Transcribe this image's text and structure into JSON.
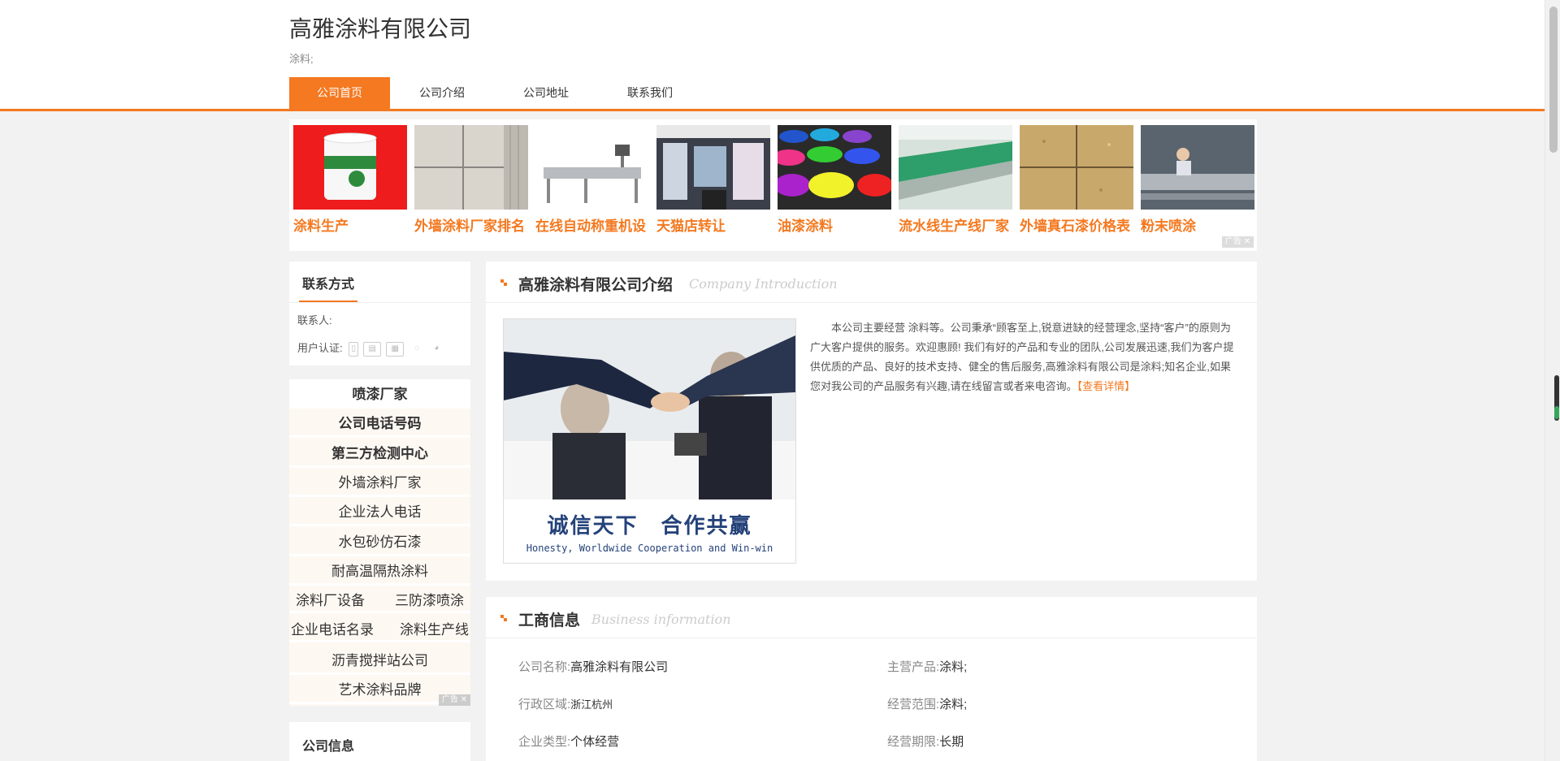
{
  "header": {
    "title": "高雅涂料有限公司",
    "subtitle": "涂料;",
    "nav": [
      "公司首页",
      "公司介绍",
      "公司地址",
      "联系我们"
    ]
  },
  "ads": {
    "items": [
      "涂料生产",
      "外墙涂料厂家排名",
      "在线自动称重机设",
      "天猫店转让",
      "油漆涂料",
      "流水线生产线厂家",
      "外墙真石漆价格表",
      "粉末喷涂"
    ],
    "tag": "广告 ✕"
  },
  "contact": {
    "title": "联系方式",
    "person_label": "联系人:",
    "auth_label": "用户认证:"
  },
  "keywords": {
    "bold": [
      "喷漆厂家",
      "公司电话号码",
      "第三方检测中心"
    ],
    "single": [
      "外墙涂料厂家",
      "企业法人电话",
      "水包砂仿石漆",
      "耐高温隔热涂料"
    ],
    "pairs": [
      [
        "涂料厂设备",
        "三防漆喷涂"
      ],
      [
        "企业电话名录",
        "涂料生产线"
      ]
    ],
    "last": [
      "沥青搅拌站公司",
      "艺术涂料品牌"
    ],
    "tag": "广告 ✕"
  },
  "company_info": {
    "title": "公司信息"
  },
  "intro": {
    "title": "高雅涂料有限公司介绍",
    "title_en": "Company Introduction",
    "text": "本公司主要经营 涂料等。公司秉承“顾客至上,锐意进缺的经营理念,坚持“客户”的原则为广大客户提供的服务。欢迎惠顾! 我们有好的产品和专业的团队,公司发展迅速,我们为客户提供优质的产品、良好的技术支持、健全的售后服务,高雅涂料有限公司是涂料;知名企业,如果您对我公司的产品服务有兴趣,请在线留言或者来电咨询。",
    "more": "【查看详情】",
    "banner_cn": "诚信天下　合作共赢",
    "banner_en": "Honesty, Worldwide Cooperation and Win-win"
  },
  "business": {
    "title": "工商信息",
    "title_en": "Business information",
    "left": [
      {
        "k": "公司名称:",
        "v": "高雅涂料有限公司"
      },
      {
        "k": "行政区域:",
        "v": "浙江杭州"
      },
      {
        "k": "企业类型:",
        "v": "个体经营"
      }
    ],
    "right": [
      {
        "k": "主营产品:",
        "v": "涂料;"
      },
      {
        "k": "经营范围:",
        "v": "涂料;"
      },
      {
        "k": "经营期限:",
        "v": "长期"
      }
    ]
  },
  "colors": {
    "accent": "#f47920",
    "page_bg": "#f2f2f2"
  }
}
